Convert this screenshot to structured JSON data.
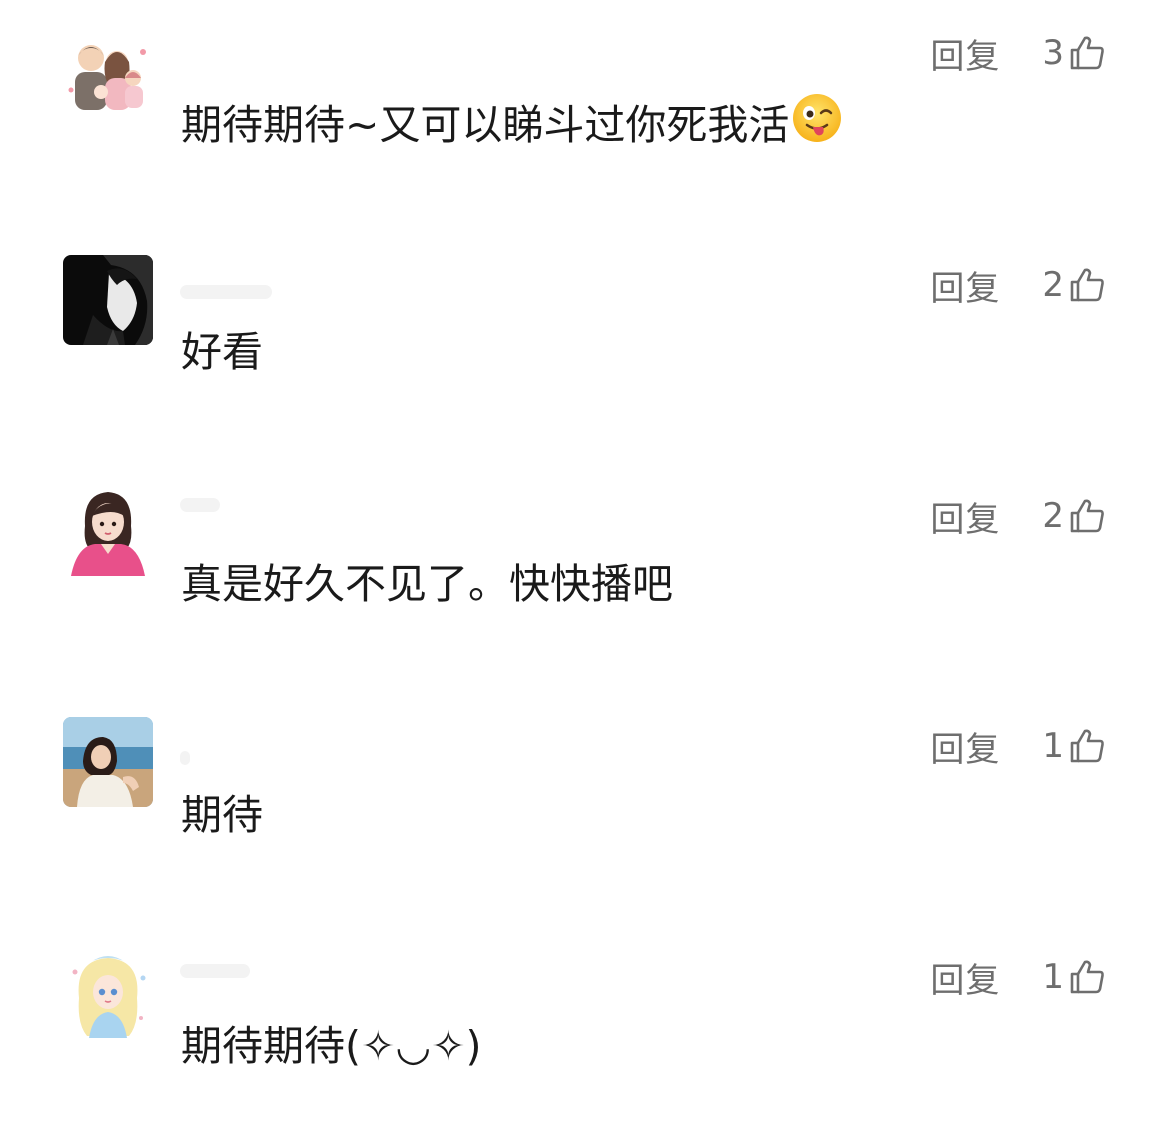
{
  "comments": [
    {
      "text": "期待期待~又可以睇斗过你死我活",
      "emoji": "winking-face-with-tongue",
      "reply_label": "回复",
      "likes": "3",
      "avatar": "family-cartoon-avatar"
    },
    {
      "text": "好看",
      "reply_label": "回复",
      "likes": "2",
      "avatar": "dark-anime-avatar"
    },
    {
      "text": "真是好久不见了。快快播吧",
      "reply_label": "回复",
      "likes": "2",
      "avatar": "girl-pink-jacket-avatar"
    },
    {
      "text": "期待",
      "reply_label": "回复",
      "likes": "1",
      "avatar": "beach-photo-avatar"
    },
    {
      "text": "期待期待(✧◡✧)",
      "reply_label": "回复",
      "likes": "1",
      "avatar": "pastel-anime-girl-avatar"
    }
  ],
  "colors": {
    "text": "#1a1a1a",
    "meta": "#6e6e6e",
    "background": "#ffffff"
  }
}
